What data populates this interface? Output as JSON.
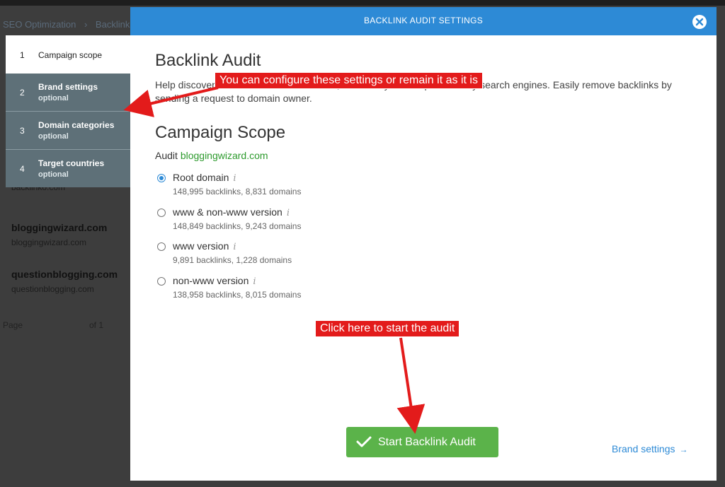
{
  "background": {
    "breadcrumb": [
      "SEO Optimization",
      "›",
      "Backlink A"
    ],
    "list_items": [
      {
        "title": "",
        "sub": "backlinko.com"
      },
      {
        "title": "bloggingwizard.com",
        "sub": "bloggingwizard.com"
      },
      {
        "title": "questionblogging.com",
        "sub": "questionblogging.com"
      }
    ],
    "pager": {
      "label": "Page",
      "of": "of 1"
    }
  },
  "steps": [
    {
      "num": "1",
      "label": "Campaign scope",
      "sub": ""
    },
    {
      "num": "2",
      "label": "Brand settings",
      "sub": "optional"
    },
    {
      "num": "3",
      "label": "Domain categories",
      "sub": "optional"
    },
    {
      "num": "4",
      "label": "Target countries",
      "sub": "optional"
    }
  ],
  "modal": {
    "title": "BACKLINK AUDIT SETTINGS",
    "heading": "Backlink Audit",
    "description": "Help discover and remove toxic backlinks, which may lead to penalties by search engines. Easily remove backlinks by sending a request to domain owner.",
    "scope_heading": "Campaign Scope",
    "audit_prefix": "Audit",
    "audit_domain": "bloggingwizard.com",
    "options": [
      {
        "label": "Root domain",
        "stats": "148,995 backlinks, 8,831 domains",
        "checked": true
      },
      {
        "label": "www & non-www version",
        "stats": "148,849 backlinks, 9,243 domains",
        "checked": false
      },
      {
        "label": "www version",
        "stats": "9,891 backlinks, 1,228 domains",
        "checked": false
      },
      {
        "label": "non-www version",
        "stats": "138,958 backlinks, 8,015 domains",
        "checked": false
      }
    ],
    "info_icon_glyph": "i",
    "start_button": "Start Backlink Audit",
    "next_link": "Brand settings",
    "next_arrow": "→"
  },
  "annotations": {
    "settings_note": "You can configure these settings or remain it as it is",
    "start_note": "Click here to start the audit"
  },
  "colors": {
    "header_blue": "#2d8ad6",
    "start_green": "#5bb34a",
    "annotation_red": "#e31b1b",
    "steps_gray": "#5e7078"
  }
}
